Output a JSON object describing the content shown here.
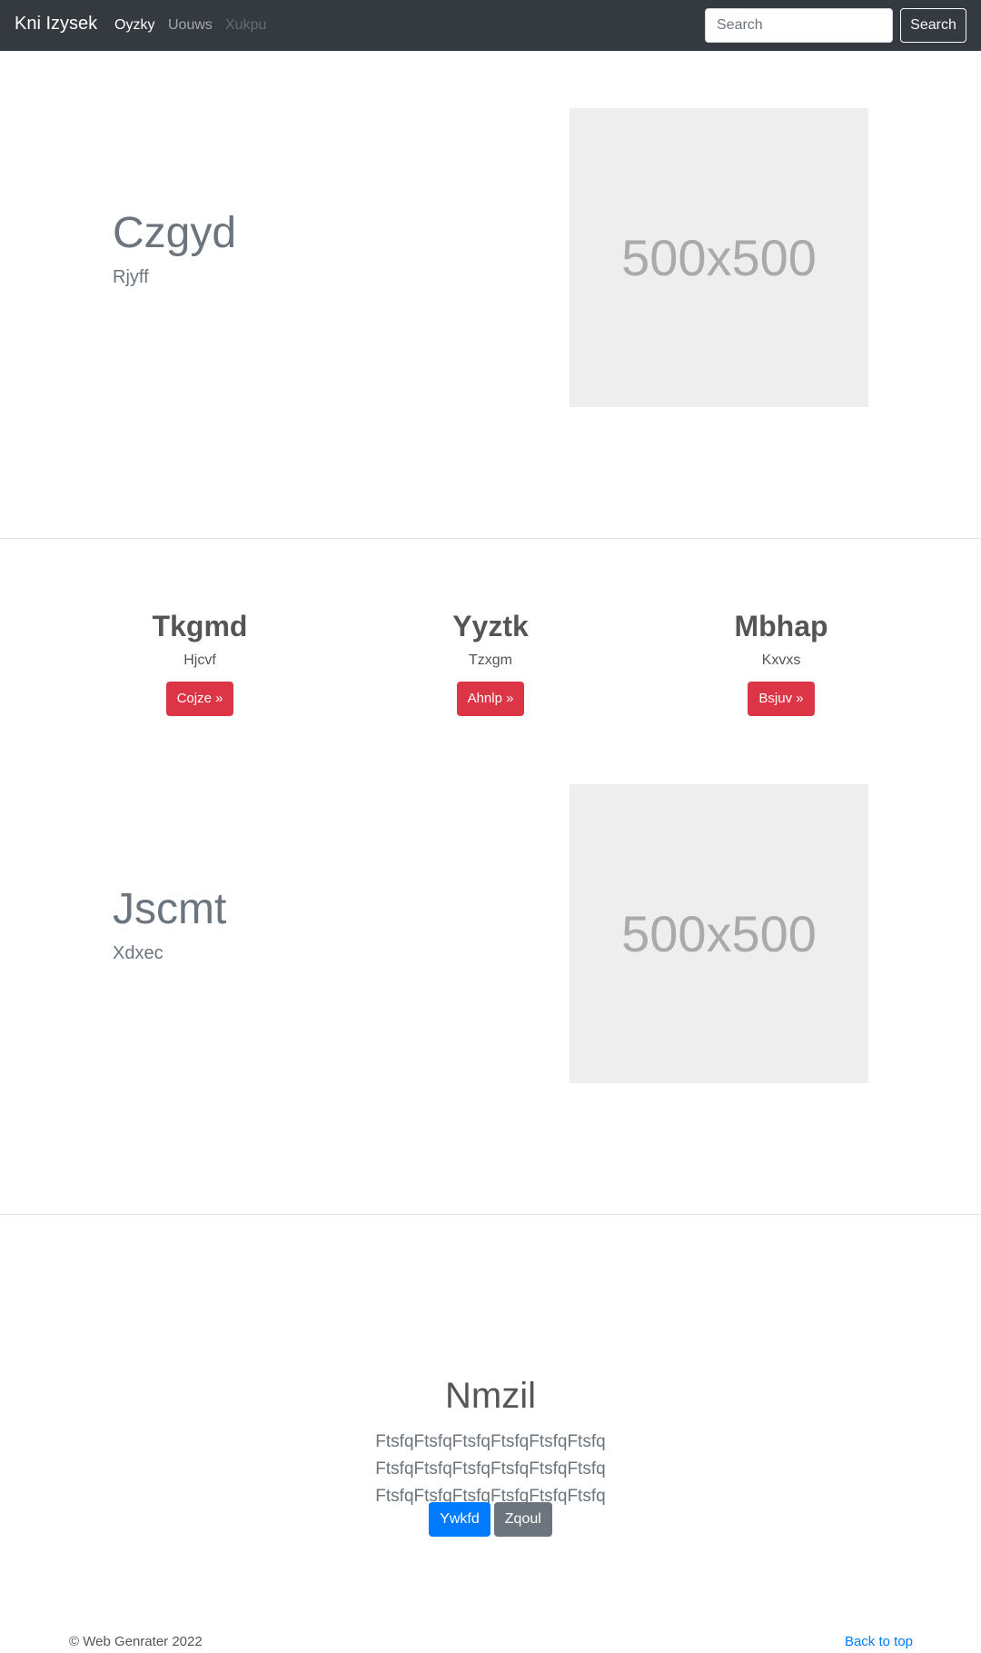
{
  "navbar": {
    "brand": "Kni Izysek",
    "links": [
      {
        "label": "Oyzky",
        "state": "active"
      },
      {
        "label": "Uouws",
        "state": "normal"
      },
      {
        "label": "Xukpu",
        "state": "disabled"
      }
    ],
    "search_placeholder": "Search",
    "search_button": "Search"
  },
  "featurette1": {
    "heading": "Czgyd",
    "lead": "Rjyff",
    "image_label": "500x500"
  },
  "columns": [
    {
      "title": "Tkgmd",
      "text": "Hjcvf",
      "button": "Cojze »"
    },
    {
      "title": "Yyztk",
      "text": "Tzxgm",
      "button": "Ahnlp »"
    },
    {
      "title": "Mbhap",
      "text": "Kxvxs",
      "button": "Bsjuv »"
    }
  ],
  "featurette2": {
    "heading": "Jscmt",
    "lead": "Xdxec",
    "image_label": "500x500"
  },
  "jumbotron": {
    "title": "Nmzil",
    "text": "FtsfqFtsfqFtsfqFtsfqFtsfqFtsfq FtsfqFtsfqFtsfqFtsfqFtsfqFtsfq FtsfqFtsfqFtsfqFtsfqFtsfqFtsfq",
    "primary_button": "Ywkfd",
    "secondary_button": "Zqoul"
  },
  "footer": {
    "copyright": "© Web Genrater 2022",
    "back_to_top": "Back to top"
  },
  "colors": {
    "navbar_bg": "#343a40",
    "danger": "#dc3545",
    "primary": "#007bff",
    "secondary": "#6c757d",
    "placeholder_bg": "#eeeeee"
  }
}
